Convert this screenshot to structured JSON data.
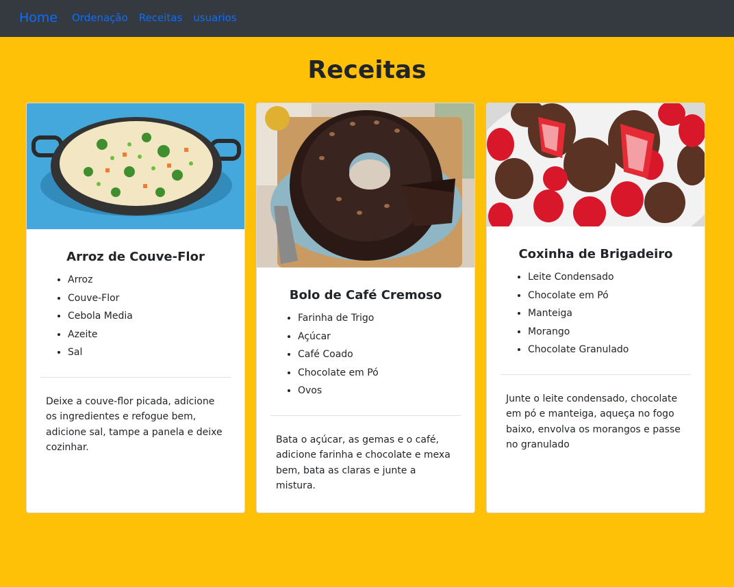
{
  "navbar": {
    "brand": "Home",
    "links": [
      "Ordenação",
      "Receitas",
      "usuarios"
    ]
  },
  "page": {
    "title": "Receitas"
  },
  "recipes": [
    {
      "title": "Arroz de Couve-Flor",
      "ingredients": [
        "Arroz",
        "Couve-Flor",
        "Cebola Media",
        "Azeite",
        "Sal"
      ],
      "instructions": "Deixe a couve-flor picada, adicione os ingredientes e refogue bem, adicione sal, tampe a panela e deixe cozinhar."
    },
    {
      "title": "Bolo de Café Cremoso",
      "ingredients": [
        "Farinha de Trigo",
        "Açúcar",
        "Café Coado",
        "Chocolate em Pó",
        "Ovos"
      ],
      "instructions": "Bata o açúcar, as gemas e o café, adicione farinha e chocolate e mexa bem, bata as claras e junte a mistura."
    },
    {
      "title": "Coxinha de Brigadeiro",
      "ingredients": [
        "Leite Condensado",
        "Chocolate em Pó",
        "Manteiga",
        "Morango",
        "Chocolate Granulado"
      ],
      "instructions": "Junte o leite condensado, chocolate em pó e manteiga, aqueça no fogo baixo, envolva os morangos e passe no granulado"
    }
  ],
  "colors": {
    "background": "#ffc107",
    "navbar": "#343a40",
    "link": "#0d6efd"
  }
}
